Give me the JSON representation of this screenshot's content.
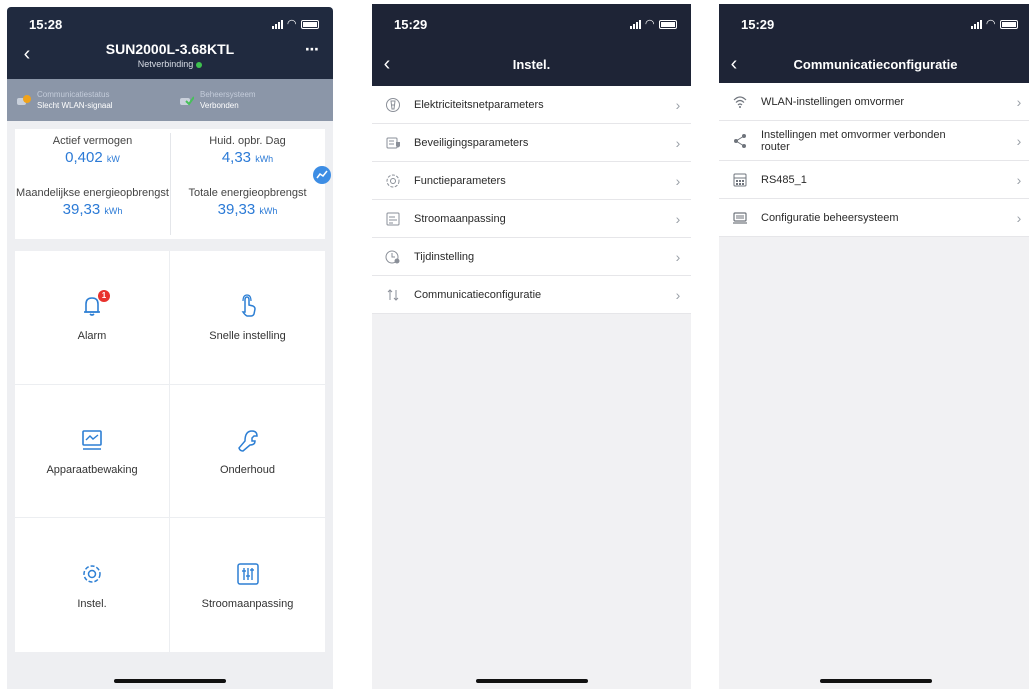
{
  "phone1": {
    "time": "15:28",
    "title": "SUN2000L-3.68KTL",
    "subtitle": "Netverbinding",
    "status": [
      {
        "label": "Communicatiestatus",
        "value": "Slecht WLAN-signaal",
        "icon": "wifi-warning-icon",
        "color": "#f0a31b"
      },
      {
        "label": "Beheersysteem",
        "value": "Verbonden",
        "icon": "management-connected-icon",
        "color": "#47c05a"
      }
    ],
    "energy": [
      {
        "label": "Actief vermogen",
        "value": "0,402",
        "unit": "kW"
      },
      {
        "label": "Huid. opbr. Dag",
        "value": "4,33",
        "unit": "kWh"
      },
      {
        "label": "Maandelijkse energieopbrengst",
        "value": "39,33",
        "unit": "kWh"
      },
      {
        "label": "Totale energieopbrengst",
        "value": "39,33",
        "unit": "kWh"
      }
    ],
    "tiles": [
      {
        "label": "Alarm",
        "icon": "alarm-bell-icon",
        "badge": "1"
      },
      {
        "label": "Snelle instelling",
        "icon": "quick-setting-hand-icon"
      },
      {
        "label": "Apparaatbewaking",
        "icon": "device-monitoring-icon"
      },
      {
        "label": "Onderhoud",
        "icon": "maintenance-wrench-icon"
      },
      {
        "label": "Instel.",
        "icon": "settings-gear-icon"
      },
      {
        "label": "Stroomaanpassing",
        "icon": "power-adjustment-sliders-icon"
      }
    ]
  },
  "phone2": {
    "time": "15:29",
    "title": "Instel.",
    "items": [
      {
        "label": "Elektriciteitsnetparameters",
        "icon": "grid-parameters-icon"
      },
      {
        "label": "Beveiligingsparameters",
        "icon": "protection-parameters-icon"
      },
      {
        "label": "Functieparameters",
        "icon": "function-parameters-icon"
      },
      {
        "label": "Stroomaanpassing",
        "icon": "power-adjustment-icon"
      },
      {
        "label": "Tijdinstelling",
        "icon": "time-setting-icon"
      },
      {
        "label": "Communicatieconfiguratie",
        "icon": "communication-configuration-icon"
      }
    ]
  },
  "phone3": {
    "time": "15:29",
    "title": "Communicatieconfiguratie",
    "items": [
      {
        "label": "WLAN-instellingen omvormer",
        "icon": "wlan-icon"
      },
      {
        "label": "Instellingen met omvormer verbonden router",
        "icon": "share-router-icon"
      },
      {
        "label": "RS485_1",
        "icon": "rs485-icon"
      },
      {
        "label": "Configuratie beheersysteem",
        "icon": "management-system-icon"
      }
    ]
  }
}
